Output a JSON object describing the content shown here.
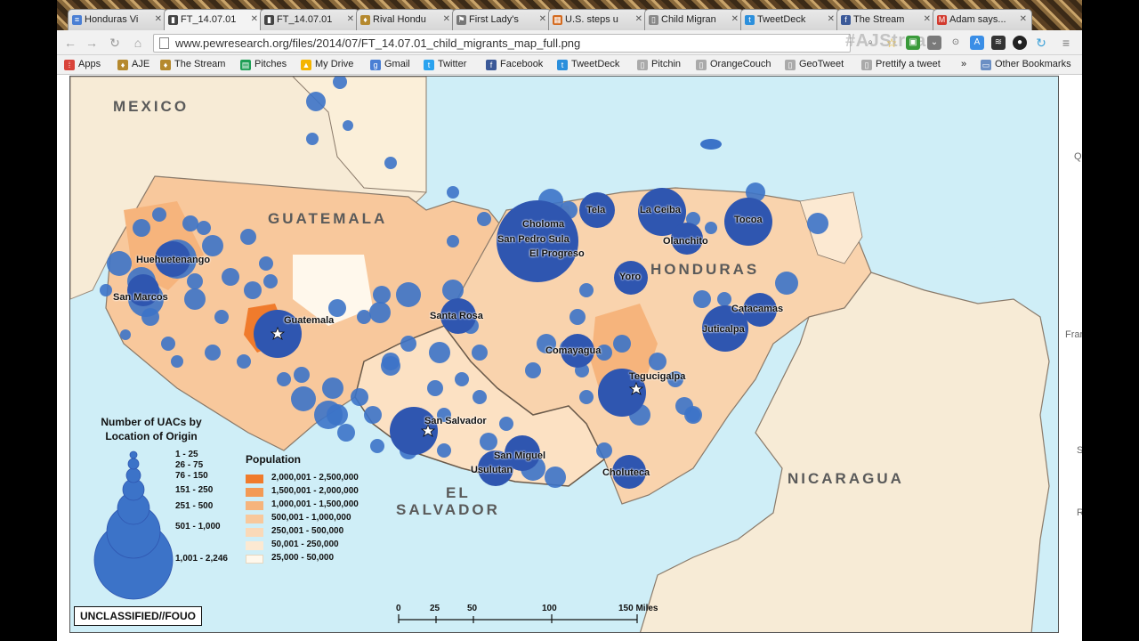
{
  "browser": {
    "tabs": [
      {
        "label": "Honduras Vi",
        "icon": "docs-icon",
        "color": "#4a7fd4"
      },
      {
        "label": "FT_14.07.01",
        "icon": "chart-icon",
        "color": "#444"
      },
      {
        "label": "FT_14.07.01",
        "icon": "chart-icon",
        "color": "#444"
      },
      {
        "label": "Rival Hondu",
        "icon": "aje-icon",
        "color": "#b5892e"
      },
      {
        "label": "First Lady's",
        "icon": "flag-icon",
        "color": "#777"
      },
      {
        "label": "U.S. steps u",
        "icon": "grid-icon",
        "color": "#d46a1e"
      },
      {
        "label": "Child Migran",
        "icon": "page-icon",
        "color": "#888"
      },
      {
        "label": "TweetDeck",
        "icon": "tweetdeck-icon",
        "color": "#2b8fdc"
      },
      {
        "label": "The Stream",
        "icon": "facebook-icon",
        "color": "#3b5998"
      },
      {
        "label": "Adam says...",
        "icon": "gmail-icon",
        "color": "#d23a2e"
      }
    ],
    "url": "www.pewresearch.org/files/2014/07/FT_14.07.01_child_migrants_map_full.png",
    "watermark": "#AJStream",
    "bookmarks": [
      {
        "label": "Apps",
        "icon": "apps-icon",
        "color": "#d9443a"
      },
      {
        "label": "AJE",
        "icon": "aje-icon",
        "color": "#b5892e"
      },
      {
        "label": "The Stream",
        "icon": "stream-icon",
        "color": "#b5892e"
      },
      {
        "label": "Pitches",
        "icon": "sheets-icon",
        "color": "#1e9e55"
      },
      {
        "label": "My Drive",
        "icon": "drive-icon",
        "color": "#f4b400"
      },
      {
        "label": "Gmail",
        "icon": "google-icon",
        "color": "#4a7fd4"
      },
      {
        "label": "Twitter",
        "icon": "twitter-icon",
        "color": "#2aa3ef"
      },
      {
        "label": "Facebook",
        "icon": "facebook-icon",
        "color": "#3b5998"
      },
      {
        "label": "TweetDeck",
        "icon": "tweetdeck-icon",
        "color": "#2b8fdc"
      },
      {
        "label": "Pitchin",
        "icon": "page-icon",
        "color": "#888"
      },
      {
        "label": "OrangeCouch",
        "icon": "page-icon",
        "color": "#888"
      },
      {
        "label": "GeoTweet",
        "icon": "page-icon",
        "color": "#888"
      },
      {
        "label": "Prettify a tweet",
        "icon": "page-icon",
        "color": "#888"
      },
      {
        "label": "»",
        "icon": "overflow-icon",
        "color": "#888"
      },
      {
        "label": "Other Bookmarks",
        "icon": "folder-icon",
        "color": "#6b8fc4"
      }
    ]
  },
  "map": {
    "countries": {
      "mexico": "MEXICO",
      "guatemala": "GUATEMALA",
      "honduras": "HONDURAS",
      "nicaragua": "NICARAGUA",
      "el": "EL",
      "salvador": "SALVADOR"
    },
    "cities": {
      "huehuetenango": "Huehuetenango",
      "san_marcos": "San Marcos",
      "guatemala": "Guatemala",
      "santa_rosa": "Santa Rosa",
      "san_salvador": "San Salvador",
      "san_miguel": "San Miguel",
      "usulutan": "Usulutan",
      "choloma": "Choloma",
      "san_pedro_sula": "San Pedro Sula",
      "el_progreso": "El Progreso",
      "tela": "Tela",
      "la_ceiba": "La Ceiba",
      "olanchito": "Olanchito",
      "tocoa": "Tocoa",
      "yoro": "Yoro",
      "catacamas": "Catacamas",
      "juticalpa": "Juticalpa",
      "comayagua": "Comayagua",
      "tegucigalpa": "Tegucigalpa",
      "choluteca": "Choluteca"
    },
    "uac_legend": {
      "title_line1": "Number of UACs by",
      "title_line2": "Location of Origin",
      "classes": [
        "1 - 25",
        "26 - 75",
        "76 - 150",
        "151 - 250",
        "251 - 500",
        "501 - 1,000",
        "1,001 - 2,246"
      ]
    },
    "population_legend": {
      "title": "Population",
      "classes": [
        {
          "label": "2,000,001 - 2,500,000",
          "color": "#f07b2c"
        },
        {
          "label": "1,500,001 - 2,000,000",
          "color": "#f39a55"
        },
        {
          "label": "1,000,001 - 1,500,000",
          "color": "#f6b47c"
        },
        {
          "label": "500,001 - 1,000,000",
          "color": "#f8c89c"
        },
        {
          "label": "250,001 - 500,000",
          "color": "#fad9b8"
        },
        {
          "label": "50,001 - 250,000",
          "color": "#fce9d2"
        },
        {
          "label": "25,000 - 50,000",
          "color": "#fff8ec"
        }
      ]
    },
    "scale": {
      "ticks": [
        "0",
        "25",
        "50",
        "100",
        "150 Miles"
      ]
    },
    "classification": "UNCLASSIFIED//FOUO",
    "colors": {
      "water": "#cfeef7",
      "dot": "#3c73c8",
      "dot_dark": "#2f56b0",
      "land": "#f7ebd6"
    }
  },
  "edge_letters": [
    "Q",
    "Fran",
    "S",
    "R"
  ]
}
